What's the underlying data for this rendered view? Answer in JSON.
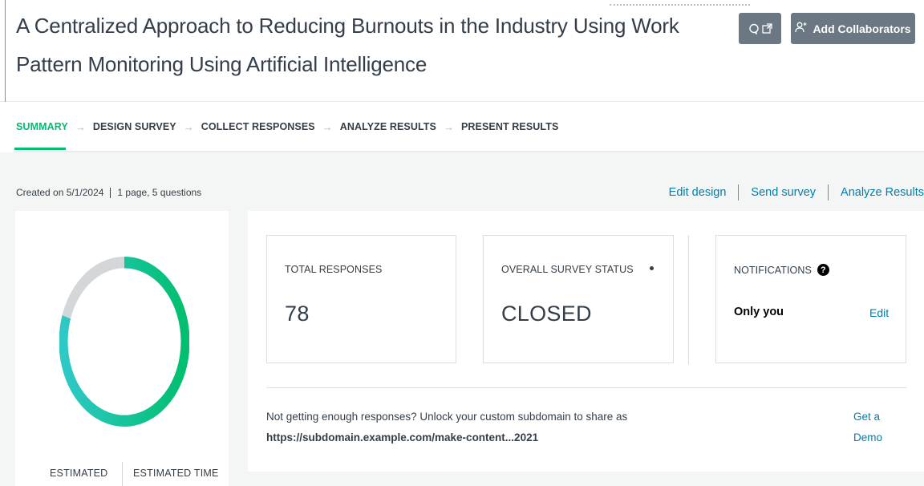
{
  "header": {
    "title": "A Centralized Approach to Reducing Burnouts in the Industry Using Work Pattern Monitoring Using Artificial Intelligence",
    "feedback_icons": [
      "chat-bubble-icon",
      "external-link-icon"
    ],
    "add_collaborators_label": "Add Collaborators"
  },
  "nav": {
    "items": [
      {
        "label": "SUMMARY",
        "active": true
      },
      {
        "label": "DESIGN SURVEY"
      },
      {
        "label": "COLLECT RESPONSES"
      },
      {
        "label": "ANALYZE RESULTS"
      },
      {
        "label": "PRESENT RESULTS"
      }
    ],
    "arrow": "→"
  },
  "meta": {
    "created": "Created on 5/1/2024",
    "pages_questions": "1 page, 5 questions"
  },
  "actions": {
    "edit_design": "Edit design",
    "send_survey": "Send survey",
    "analyze_results": "Analyze Results"
  },
  "left_panel": {
    "donut_progress": 0.8,
    "estimated_label": "ESTIMATED",
    "estimated_time_label": "ESTIMATED TIME"
  },
  "cards": {
    "total_responses_label": "TOTAL RESPONSES",
    "total_responses_value": "78",
    "status_label": "OVERALL SURVEY STATUS",
    "status_value": "CLOSED",
    "notifications_label": "NOTIFICATIONS",
    "notifications_value": "Only you",
    "notifications_edit": "Edit"
  },
  "promo": {
    "text": "Not getting enough responses? Unlock your custom subdomain to share as",
    "url": "https://subdomain.example.com/make-content...2021",
    "cta": "Get a Demo"
  },
  "colors": {
    "accent": "#00bf6f",
    "teal": "#2ec9c6",
    "link": "#007faa",
    "button": "#6b7782",
    "track": "#d4d7d9"
  }
}
